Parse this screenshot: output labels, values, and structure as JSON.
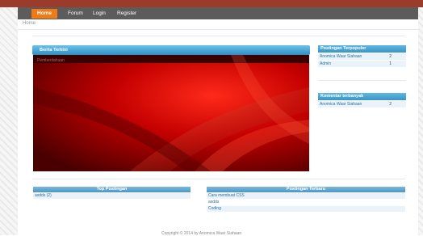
{
  "nav": {
    "items": [
      "Home",
      "Forum",
      "Login",
      "Register"
    ]
  },
  "breadcrumb": "Home",
  "hero": {
    "title": "Berita Terkini",
    "caption": "Pemberitahuan"
  },
  "postingan_terpopuler": {
    "title": "Postingan Terpopuler",
    "rows": [
      {
        "name": "Anomica Waar Siahaan",
        "count": "2"
      },
      {
        "name": "Admin",
        "count": "1"
      }
    ]
  },
  "komentar_terbanyak": {
    "title": "Komentar terbanyak",
    "rows": [
      {
        "name": "Anomica Waar Siahaan",
        "count": "2"
      }
    ]
  },
  "top_postingan": {
    "title": "Top Postingan",
    "items": [
      "asdds (2)"
    ]
  },
  "postingan_terbaru": {
    "title": "Postingan Terbaru",
    "items": [
      "Cara membuat CSS",
      "asdds",
      "Coding"
    ]
  },
  "footer": "Copyright © 2014 by Anomica Waar Siahaan",
  "colors": {
    "nav_bg": "#5c5c5c",
    "nav_active": "#f07a16",
    "panel_header": "#3b95c4",
    "hero_red": "#c00000"
  }
}
